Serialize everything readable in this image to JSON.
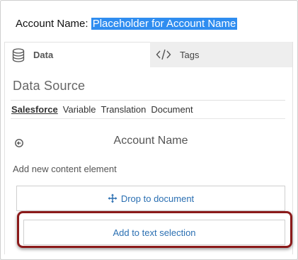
{
  "document": {
    "label": "Account Name:",
    "selected_text": "Placeholder for Account Name"
  },
  "tabs": [
    {
      "label": "Data",
      "icon": "database-icon",
      "active": true
    },
    {
      "label": "Tags",
      "icon": "code-icon",
      "active": false
    }
  ],
  "data_source": {
    "title": "Data Source",
    "sources": [
      {
        "label": "Salesforce",
        "active": true
      },
      {
        "label": "Variable",
        "active": false
      },
      {
        "label": "Translation",
        "active": false
      },
      {
        "label": "Document",
        "active": false
      }
    ]
  },
  "field": {
    "back_icon": "circle-arrow-left-icon",
    "title": "Account Name"
  },
  "content": {
    "hint": "Add new content element",
    "drop_button": "Drop to document",
    "drop_icon": "move-arrows-icon",
    "add_button": "Add to text selection"
  },
  "colors": {
    "selection": "#2f8df0",
    "link": "#2a6fb2",
    "highlight": "#8b1a1a"
  }
}
